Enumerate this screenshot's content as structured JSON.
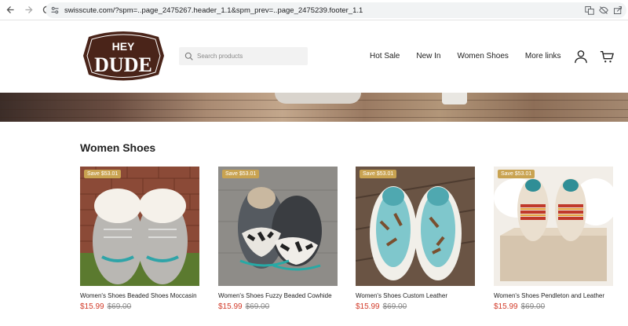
{
  "browser": {
    "url": "swisscute.com/?spm=..page_2475267.header_1.1&spm_prev=..page_2475239.footer_1.1"
  },
  "header": {
    "logo_text": "HEY DUDE",
    "search_placeholder": "Search products",
    "nav": [
      "Hot Sale",
      "New In",
      "Women Shoes",
      "More links"
    ],
    "icons": [
      "account-icon",
      "cart-icon"
    ]
  },
  "section": {
    "title": "Women Shoes"
  },
  "products": [
    {
      "badge": "Save $53.01",
      "name": "Women's Shoes Beaded Shoes Moccasin",
      "price": "$15.99",
      "old_price": "$69.00"
    },
    {
      "badge": "Save $53.01",
      "name": "Women's Shoes Fuzzy Beaded Cowhide",
      "price": "$15.99",
      "old_price": "$69.00"
    },
    {
      "badge": "Save $53.01",
      "name": "Women's Shoes Custom Leather",
      "price": "$15.99",
      "old_price": "$69.00"
    },
    {
      "badge": "Save $53.01",
      "name": "Women's Shoes Pendleton and Leather",
      "price": "$15.99",
      "old_price": "$69.00"
    }
  ],
  "colors": {
    "brand": "#4a2419",
    "badge": "#c9a351",
    "sale_price": "#d23b2a"
  }
}
